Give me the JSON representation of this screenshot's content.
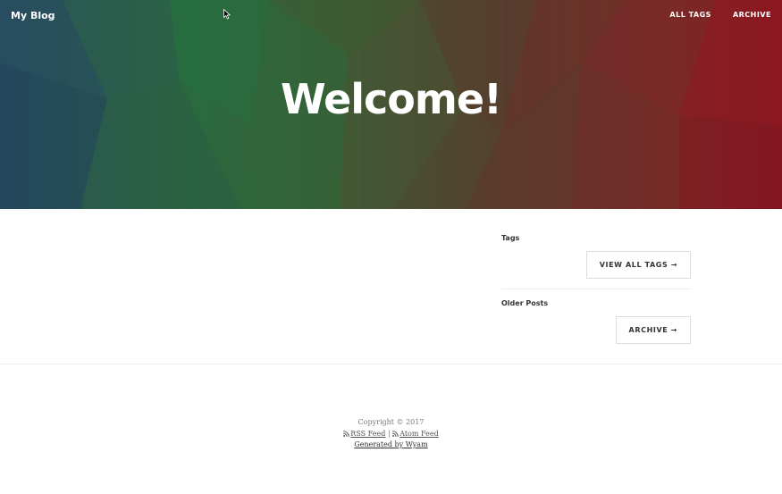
{
  "header": {
    "brand": "My Blog",
    "nav": [
      {
        "label": "ALL TAGS"
      },
      {
        "label": "ARCHIVE"
      }
    ],
    "title": "Welcome!"
  },
  "sidebar": {
    "tags_heading": "Tags",
    "tags_button": "VIEW ALL TAGS →",
    "older_heading": "Older Posts",
    "archive_button": "ARCHIVE →"
  },
  "footer": {
    "copyright": "Copyright © 2017",
    "rss_label": "RSS Feed",
    "separator": "|",
    "atom_label": "Atom Feed",
    "generated": "Generated by Wyam"
  },
  "icons": {
    "feed": "rss-icon",
    "pointer": "mouse-cursor-icon"
  },
  "colors": {
    "hero_left": "#2a4f63",
    "hero_green": "#2a6a3e",
    "hero_right": "#8a1420",
    "text_on_hero": "#ffffff"
  }
}
